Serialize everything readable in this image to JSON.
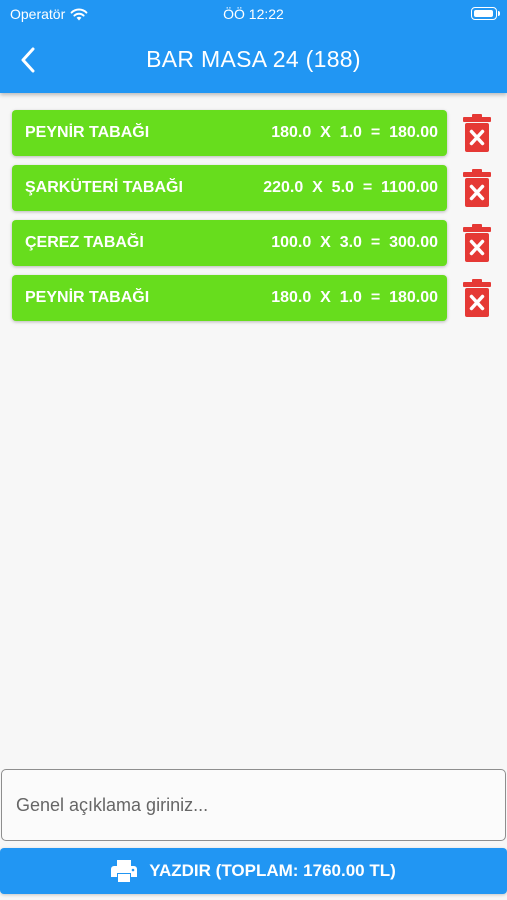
{
  "status_bar": {
    "carrier": "Operatör",
    "time": "ÖÖ 12:22"
  },
  "header": {
    "title": "BAR MASA 24 (188)",
    "back_icon": "chevron-left-icon"
  },
  "items": [
    {
      "name": "PEYNİR TABAĞI",
      "calc": "180.0  X  1.0  =  180.00"
    },
    {
      "name": "ŞARKÜTERİ TABAĞI",
      "calc": "220.0  X  5.0  =  1100.00"
    },
    {
      "name": "ÇEREZ TABAĞI",
      "calc": "100.0  X  3.0  =  300.00"
    },
    {
      "name": "PEYNİR TABAĞI",
      "calc": "180.0  X  1.0  =  180.00"
    }
  ],
  "note": {
    "placeholder": "Genel açıklama giriniz...",
    "value": ""
  },
  "print_button": {
    "label": "YAZDIR (TOPLAM: 1760.00 TL)",
    "icon": "printer-icon"
  },
  "colors": {
    "primary": "#2196f3",
    "item_bg": "#67dd1d",
    "delete": "#e53935"
  }
}
